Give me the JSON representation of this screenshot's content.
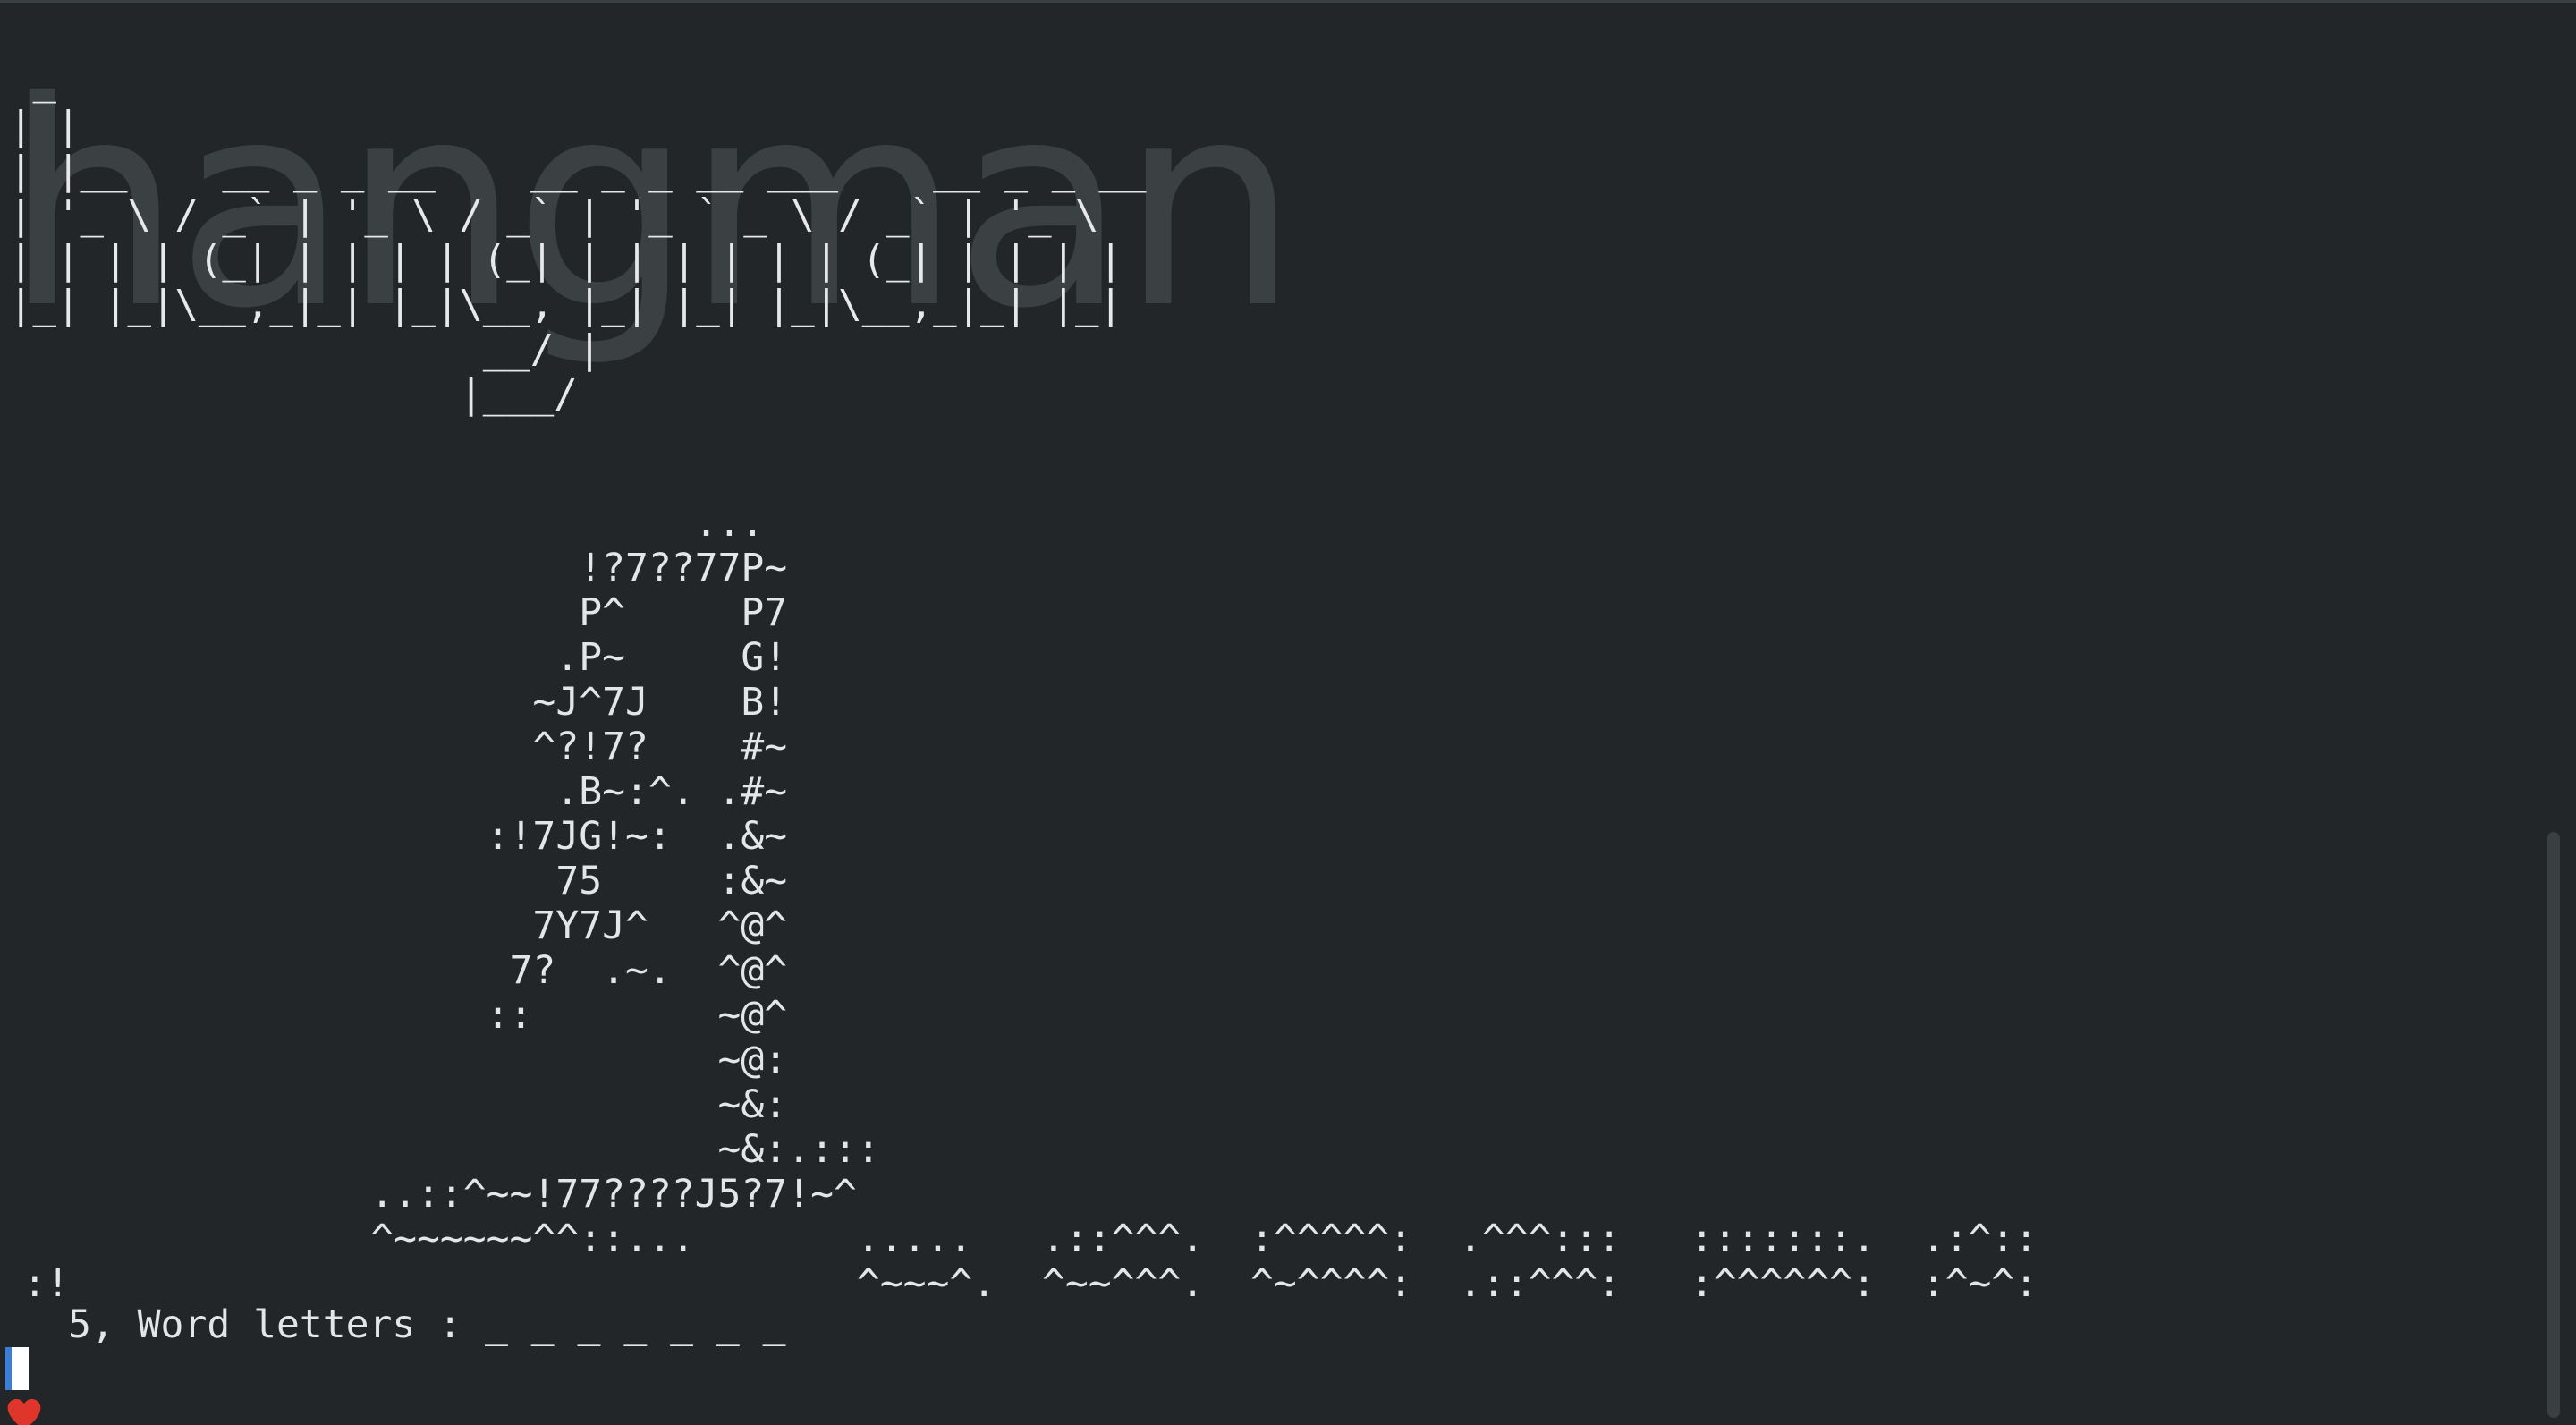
{
  "terminal": {
    "logo_ascii": " _\n| |\n| |__    __ _ _ __    __ _ _ __ ___    __ _ _ __\n| '_ \\ / _` | '_ \\ / _` | '_ ` _ \\ / _` | '_ \\\n| | | | (_| | | | | (_| | | | | | | (_| | | | |\n|_| |_|\\__,_|_| |_|\\__, |_| |_| |_|\\__,_|_| |_|\n                    __/ |\n                   |___/",
    "logo_ghost_text": "hangman",
    "hangman_art": "                              ...\n                         !?7??77P~\n                         P^     P7\n                        .P~     G!\n                       ~J^7J    B!\n                       ^?!7?    #~\n                        .B~:^. .#~\n                     :!7JG!~:  .&~\n                        75     :&~\n                       7Y7J^   ^@^\n                      7?  .~.  ^@^\n                     ::        ~@^\n                               ~@:\n                               ~&:\n                               ~&:.:::\n                ..::^~~!77????J5?7!~^\n                ^~~~~~~^^::...       .....   .::^^^.  :^^^^^:  .^^^:::   :::::::.  .:^::\n :!                                  ^~~~^.  ^~~^^^.  ^~^^^^:  .::^^^:   :^^^^^^:  :^~^:",
    "lives": "5",
    "status_text": ", Word letters : _ _ _ _ _ _ _",
    "heart_icon_color": "#e0352b"
  }
}
